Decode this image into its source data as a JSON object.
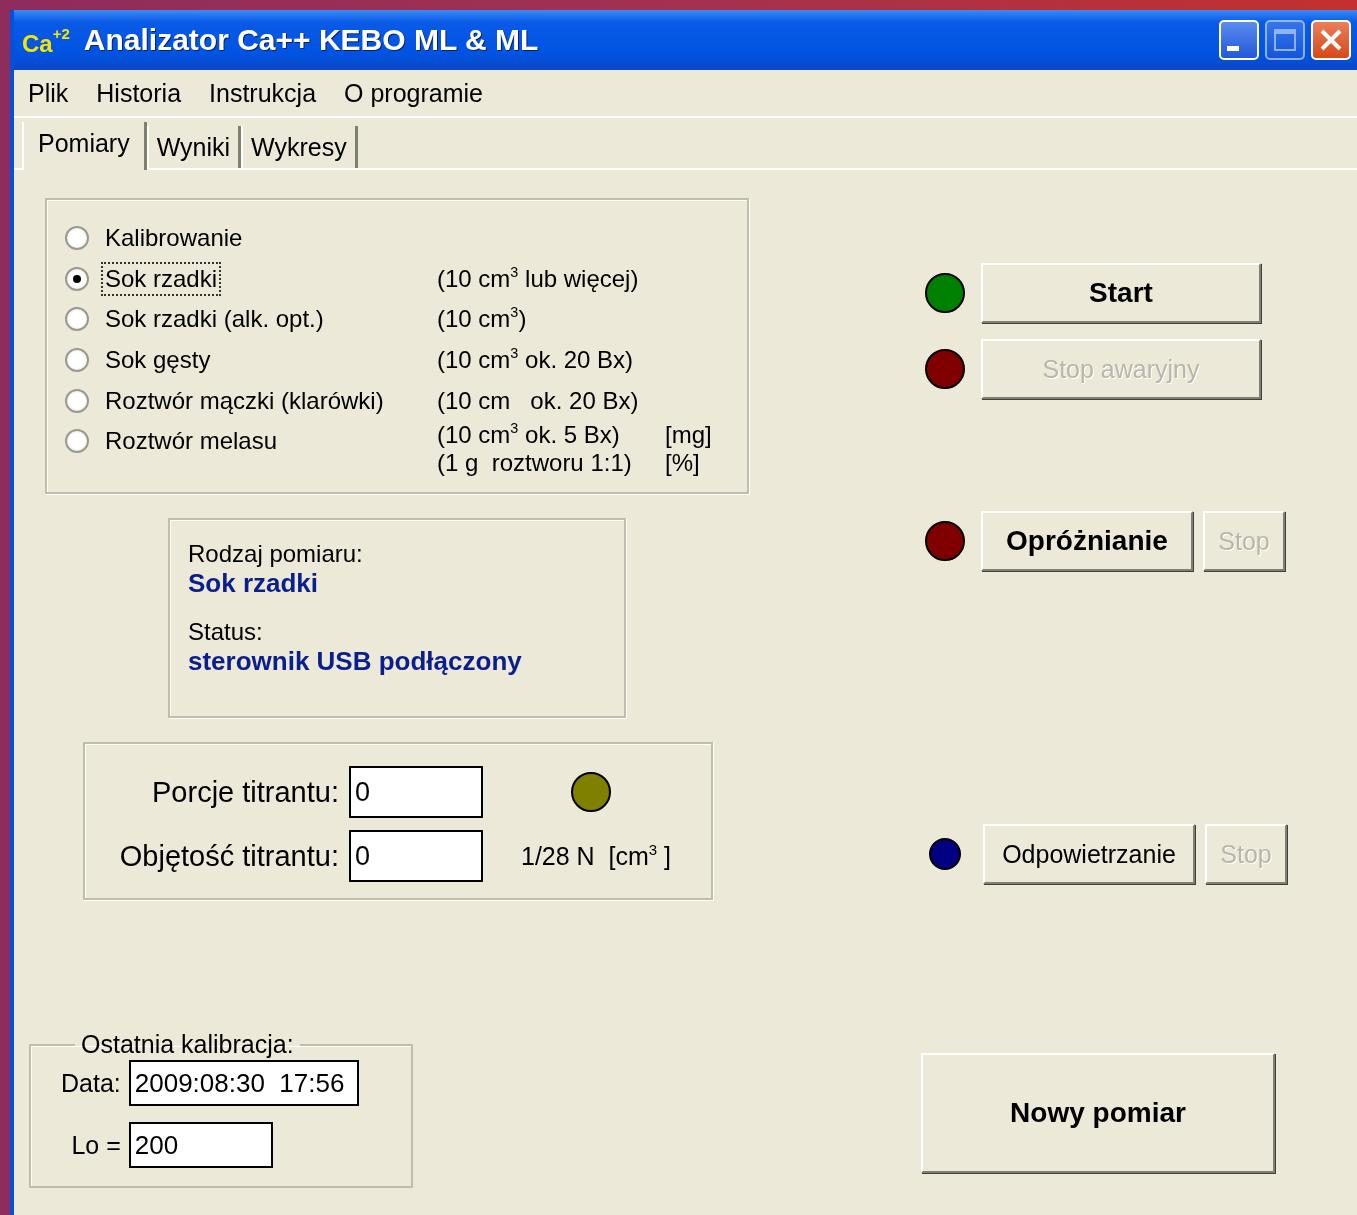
{
  "window": {
    "title": "Analizator Ca++ KEBO ML & ML",
    "icon_text": "Ca",
    "icon_superscript": "+2"
  },
  "menu": [
    "Plik",
    "Historia",
    "Instrukcja",
    "O programie"
  ],
  "tabs": [
    {
      "label": "Pomiary",
      "selected": true
    },
    {
      "label": "Wyniki",
      "selected": false
    },
    {
      "label": "Wykresy",
      "selected": false
    }
  ],
  "measurement_types": [
    {
      "label": "Kalibrowanie",
      "selected": false
    },
    {
      "label": "Sok rzadki",
      "selected": true,
      "note": "(10 cm$^{3}$ lub więcej)"
    },
    {
      "label": "Sok rzadki (alk. opt.)",
      "selected": false,
      "note": "(10 cm$^{3}$)"
    },
    {
      "label": "Sok gęsty",
      "selected": false,
      "note": "(10 cm$^{3}$ ok. 20 Bx)"
    },
    {
      "label": "Roztwór mączki (klarówki)",
      "selected": false,
      "note": "(10 cm   ok. 20 Bx)"
    },
    {
      "label": "Roztwór melasu",
      "selected": false,
      "note": "(10 cm$^{3}$ ok. 5 Bx)",
      "unit": "[mg]",
      "note_2": "(1 g  roztworu 1:1)",
      "unit_2": "[%]"
    }
  ],
  "info": {
    "type_label": "Rodzaj pomiaru:",
    "type_value": "Sok rzadki",
    "status_label": "Status:",
    "status_value": "sterownik USB podłączony"
  },
  "titrant": {
    "fields": [
      {
        "label": "Porcje titrantu:",
        "value": "0"
      },
      {
        "label": "Objętość titrantu:",
        "value": "0"
      }
    ],
    "color": "#808000",
    "unit": "1/28 N  [cm$^{3}$ ]"
  },
  "controls": [
    {
      "color": "#008000",
      "buttons": [
        {
          "label": "Start",
          "disabled": false,
          "bold": true
        }
      ]
    },
    {
      "color": "#800000",
      "buttons": [
        {
          "label": "Stop awaryjny",
          "disabled": true,
          "bold": false
        }
      ]
    },
    {
      "color": "#800000",
      "buttons": [
        {
          "label": "Opróżnianie",
          "disabled": false,
          "bold": true
        },
        {
          "label": "Stop",
          "disabled": true,
          "bold": false
        }
      ]
    },
    {
      "color": "#000080",
      "buttons": [
        {
          "label": "Odpowietrzanie",
          "disabled": false,
          "bold": false
        },
        {
          "label": "Stop",
          "disabled": true,
          "bold": false
        }
      ]
    }
  ],
  "new_measurement": {
    "label": "Nowy pomiar",
    "disabled": false
  },
  "calibration": {
    "legend": "Ostatnia kalibracja:",
    "fields": [
      {
        "label": "Data:",
        "value": "2009:08:30  17:56"
      },
      {
        "label": "Lo =",
        "value": "200"
      }
    ]
  }
}
